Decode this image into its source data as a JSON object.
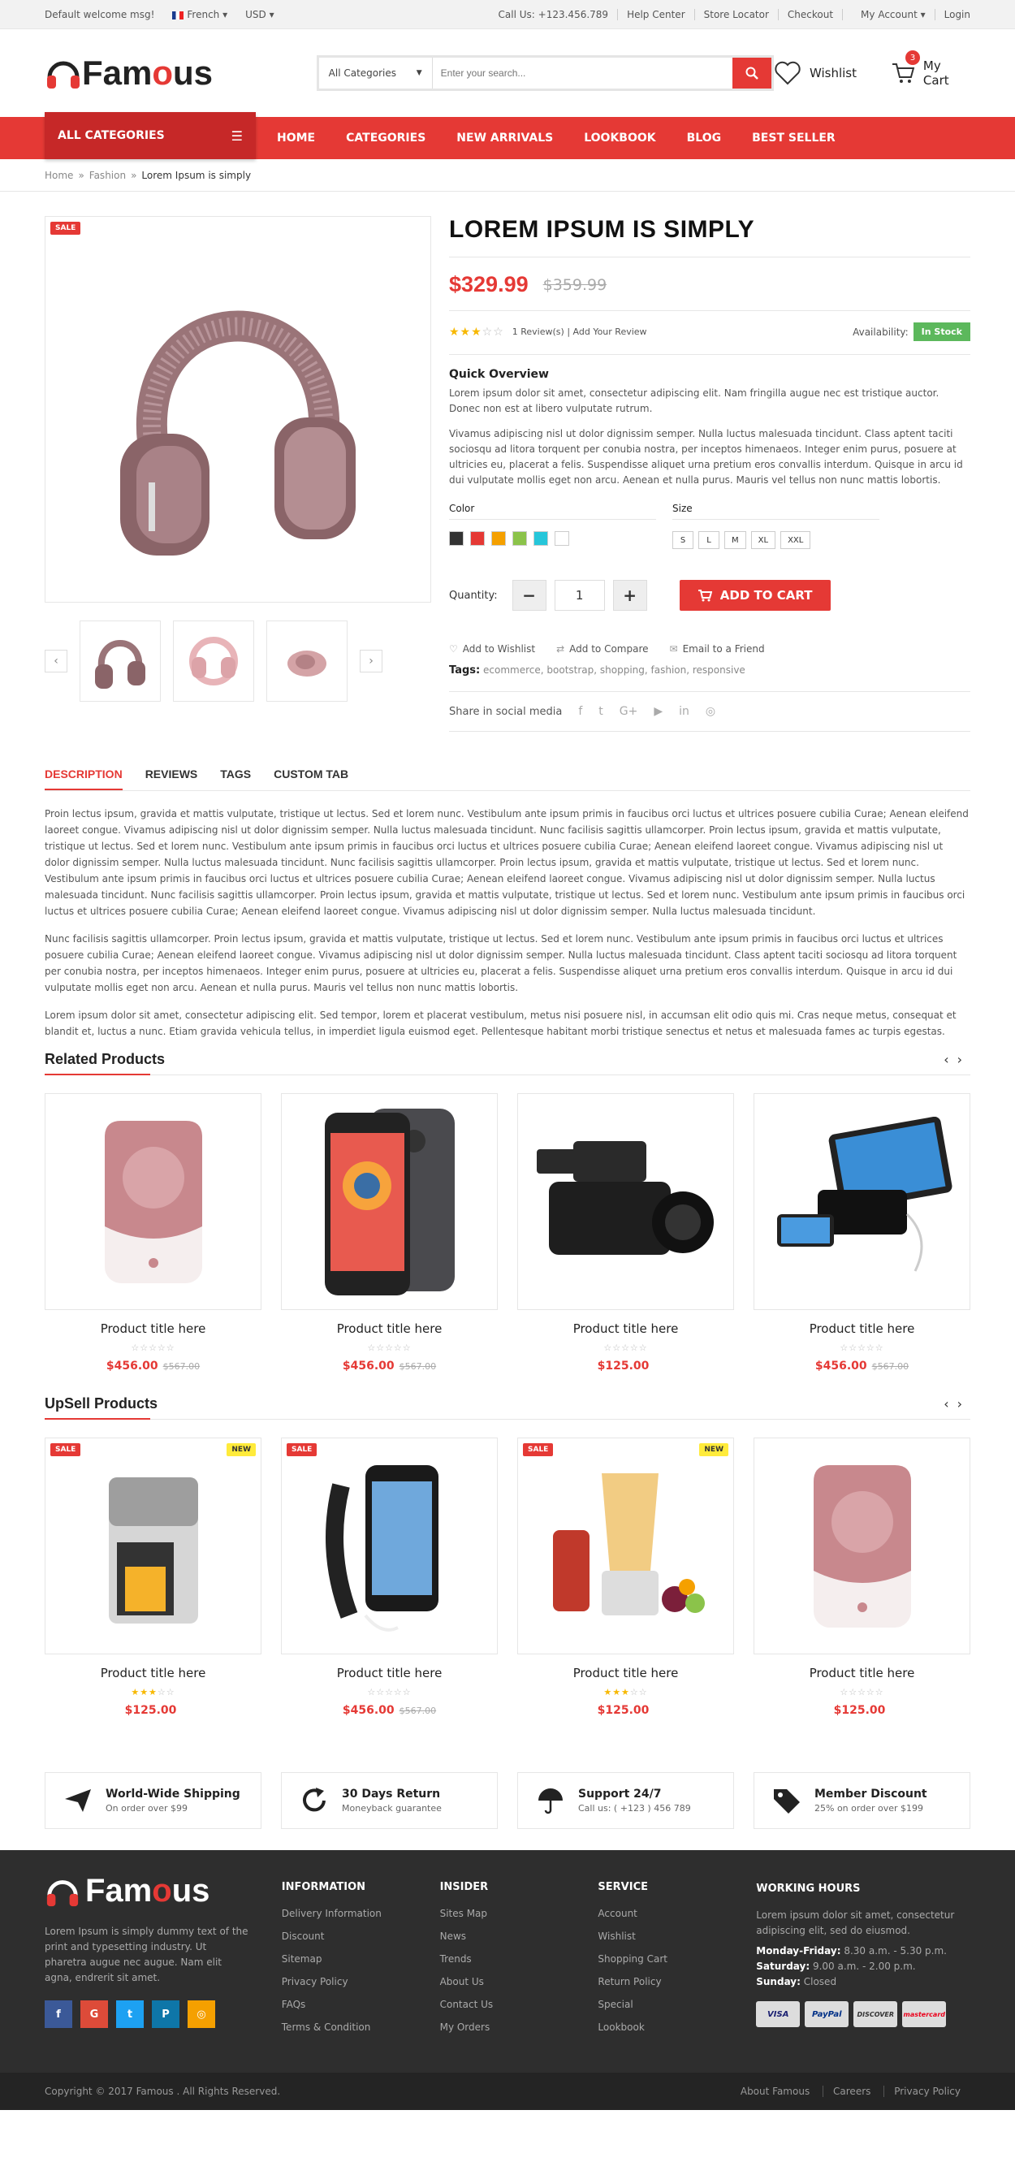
{
  "topbar": {
    "welcome": "Default welcome msg!",
    "lang": "French",
    "currency": "USD",
    "phone": "Call Us: +123.456.789",
    "links": [
      "Help Center",
      "Store Locator",
      "Checkout",
      "My Account",
      "Login"
    ]
  },
  "header": {
    "logo_a": "Fam",
    "logo_o": "o",
    "logo_b": "us",
    "search_cat": "All Categories",
    "search_ph": "Enter your search...",
    "wishlist": "Wishlist",
    "cart": "My Cart",
    "cart_count": "3"
  },
  "nav": {
    "all": "ALL CATEGORIES",
    "links": [
      "HOME",
      "CATEGORIES",
      "NEW ARRIVALS",
      "LOOKBOOK",
      "BLOG",
      "BEST SELLER"
    ]
  },
  "breadcrumb": [
    "Home",
    "Fashion",
    "Lorem Ipsum is simply"
  ],
  "product": {
    "sale": "SALE",
    "title": "LOREM IPSUM IS SIMPLY",
    "price": "$329.99",
    "old_price": "$359.99",
    "reviews": "1 Review(s) | Add Your Review",
    "availability": "Availability:",
    "stock": "In Stock",
    "quick": "Quick Overview",
    "desc1": "Lorem ipsum dolor sit amet, consectetur adipiscing elit. Nam fringilla augue nec est tristique auctor. Donec non est at libero vulputate rutrum.",
    "desc2": "Vivamus adipiscing nisl ut dolor dignissim semper. Nulla luctus malesuada tincidunt. Class aptent taciti sociosqu ad litora torquent per conubia nostra, per inceptos himenaeos. Integer enim purus, posuere at ultricies eu, placerat a felis. Suspendisse aliquet urna pretium eros convallis interdum. Quisque in arcu id dui vulputate mollis eget non arcu. Aenean et nulla purus. Mauris vel tellus non nunc mattis lobortis.",
    "color_lbl": "Color",
    "size_lbl": "Size",
    "colors": [
      "#333333",
      "#e53935",
      "#f5a000",
      "#8bc34a",
      "#26c6da",
      "#ffffff"
    ],
    "sizes": [
      "S",
      "L",
      "M",
      "XL",
      "XXL"
    ],
    "qty_lbl": "Quantity:",
    "qty": "1",
    "add_to_cart": "ADD TO CART",
    "actions": [
      "Add to Wishlist",
      "Add to Compare",
      "Email to a Friend"
    ],
    "tags_lbl": "Tags:",
    "tags": "ecommerce, bootstrap, shopping, fashion, responsive",
    "share": "Share in social media"
  },
  "tabs": [
    "DESCRIPTION",
    "REVIEWS",
    "TAGS",
    "CUSTOM TAB"
  ],
  "tab_text": [
    "Proin lectus ipsum, gravida et mattis vulputate, tristique ut lectus. Sed et lorem nunc. Vestibulum ante ipsum primis in faucibus orci luctus et ultrices posuere cubilia Curae; Aenean eleifend laoreet congue. Vivamus adipiscing nisl ut dolor dignissim semper. Nulla luctus malesuada tincidunt. Nunc facilisis sagittis ullamcorper. Proin lectus ipsum, gravida et mattis vulputate, tristique ut lectus. Sed et lorem nunc. Vestibulum ante ipsum primis in faucibus orci luctus et ultrices posuere cubilia Curae; Aenean eleifend laoreet congue. Vivamus adipiscing nisl ut dolor dignissim semper. Nulla luctus malesuada tincidunt. Nunc facilisis sagittis ullamcorper. Proin lectus ipsum, gravida et mattis vulputate, tristique ut lectus. Sed et lorem nunc. Vestibulum ante ipsum primis in faucibus orci luctus et ultrices posuere cubilia Curae; Aenean eleifend laoreet congue. Vivamus adipiscing nisl ut dolor dignissim semper. Nulla luctus malesuada tincidunt. Nunc facilisis sagittis ullamcorper. Proin lectus ipsum, gravida et mattis vulputate, tristique ut lectus. Sed et lorem nunc. Vestibulum ante ipsum primis in faucibus orci luctus et ultrices posuere cubilia Curae; Aenean eleifend laoreet congue. Vivamus adipiscing nisl ut dolor dignissim semper. Nulla luctus malesuada tincidunt.",
    "Nunc facilisis sagittis ullamcorper. Proin lectus ipsum, gravida et mattis vulputate, tristique ut lectus. Sed et lorem nunc. Vestibulum ante ipsum primis in faucibus orci luctus et ultrices posuere cubilia Curae; Aenean eleifend laoreet congue. Vivamus adipiscing nisl ut dolor dignissim semper. Nulla luctus malesuada tincidunt. Class aptent taciti sociosqu ad litora torquent per conubia nostra, per inceptos himenaeos. Integer enim purus, posuere at ultricies eu, placerat a felis. Suspendisse aliquet urna pretium eros convallis interdum. Quisque in arcu id dui vulputate mollis eget non arcu. Aenean et nulla purus. Mauris vel tellus non nunc mattis lobortis.",
    "Lorem ipsum dolor sit amet, consectetur adipiscing elit. Sed tempor, lorem et placerat vestibulum, metus nisi posuere nisl, in accumsan elit odio quis mi. Cras neque metus, consequat et blandit et, luctus a nunc. Etiam gravida vehicula tellus, in imperdiet ligula euismod eget. Pellentesque habitant morbi tristique senectus et netus et malesuada fames ac turpis egestas."
  ],
  "related": {
    "title": "Related Products",
    "items": [
      {
        "title": "Product title here",
        "price": "$456.00",
        "old": "$567.00",
        "rating": 0,
        "img": "speaker-icon"
      },
      {
        "title": "Product title here",
        "price": "$456.00",
        "old": "$567.00",
        "rating": 0,
        "img": "phone-icon"
      },
      {
        "title": "Product title here",
        "price": "$125.00",
        "old": "",
        "rating": 0,
        "img": "camcorder-icon"
      },
      {
        "title": "Product title here",
        "price": "$456.00",
        "old": "$567.00",
        "rating": 0,
        "img": "powerbank-icon"
      }
    ]
  },
  "upsell": {
    "title": "UpSell Products",
    "items": [
      {
        "title": "Product title here",
        "price": "$125.00",
        "old": "",
        "rating": 3,
        "img": "coffee-maker-icon",
        "sale": "SALE",
        "new": "NEW"
      },
      {
        "title": "Product title here",
        "price": "$456.00",
        "old": "$567.00",
        "rating": 0,
        "img": "armband-icon",
        "sale": "SALE",
        "new": ""
      },
      {
        "title": "Product title here",
        "price": "$125.00",
        "old": "",
        "rating": 3,
        "img": "blender-icon",
        "sale": "SALE",
        "new": "NEW"
      },
      {
        "title": "Product title here",
        "price": "$125.00",
        "old": "",
        "rating": 0,
        "img": "speaker-icon",
        "sale": "",
        "new": ""
      }
    ]
  },
  "features": [
    {
      "title": "World-Wide Shipping",
      "sub": "On order over $99",
      "icon": "plane-icon"
    },
    {
      "title": "30 Days Return",
      "sub": "Moneyback guarantee",
      "icon": "return-icon"
    },
    {
      "title": "Support 24/7",
      "sub": "Call us: ( +123 ) 456 789",
      "icon": "umbrella-icon"
    },
    {
      "title": "Member Discount",
      "sub": "25% on order over $199",
      "icon": "tag-icon"
    }
  ],
  "footer": {
    "about": "Lorem Ipsum is simply dummy text of the print and typesetting industry. Ut pharetra augue nec augue. Nam elit agna, endrerit sit amet.",
    "cols": [
      {
        "title": "INFORMATION",
        "items": [
          "Delivery Information",
          "Discount",
          "Sitemap",
          "Privacy Policy",
          "FAQs",
          "Terms & Condition"
        ]
      },
      {
        "title": "INSIDER",
        "items": [
          "Sites Map",
          "News",
          "Trends",
          "About Us",
          "Contact Us",
          "My Orders"
        ]
      },
      {
        "title": "SERVICE",
        "items": [
          "Account",
          "Wishlist",
          "Shopping Cart",
          "Return Policy",
          "Special",
          "Lookbook"
        ]
      }
    ],
    "hours_title": "WORKING HOURS",
    "hours_text": "Lorem ipsum dolor sit amet, consectetur adipiscing elit, sed do eiusmod.",
    "mf_lbl": "Monday-Friday:",
    "mf": "8.30 a.m. - 5.30 p.m.",
    "sat_lbl": "Saturday:",
    "sat": "9.00 a.m. - 2.00 p.m.",
    "sun_lbl": "Sunday:",
    "sun": "Closed",
    "pays": [
      "VISA",
      "PayPal",
      "DISCOVER",
      "mastercard"
    ],
    "social_colors": [
      "#3b5998",
      "#dd4b39",
      "#1da1f2",
      "#0e76a8",
      "#f5a000"
    ],
    "copyright": "Copyright © 2017 Famous . All Rights Reserved.",
    "links": [
      "About Famous",
      "Careers",
      "Privacy Policy"
    ]
  }
}
